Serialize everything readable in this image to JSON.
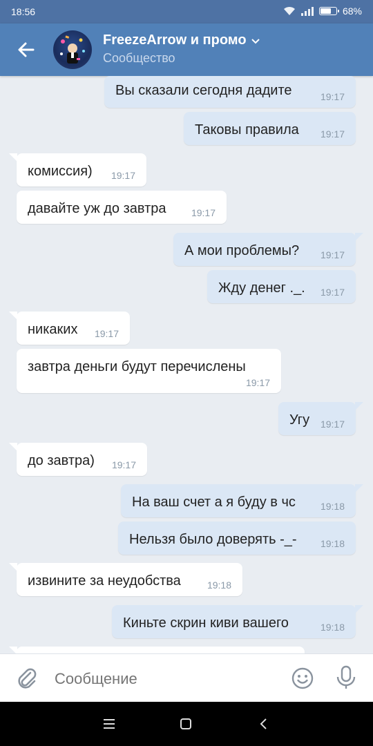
{
  "status_bar": {
    "time": "18:56",
    "battery": "68%",
    "battery_level": 0.68
  },
  "header": {
    "title": "FreezeArrow и промо",
    "subtitle": "Сообщество"
  },
  "messages": [
    {
      "dir": "out",
      "text": "Вы сказали сегодня дадите",
      "time": "19:17"
    },
    {
      "dir": "out",
      "text": "Таковы правила",
      "time": "19:17"
    },
    {
      "dir": "in",
      "text": "комиссия)",
      "time": "19:17"
    },
    {
      "dir": "in",
      "text": "давайте уж до завтра",
      "time": "19:17"
    },
    {
      "dir": "out",
      "text": "А мои проблемы?",
      "time": "19:17"
    },
    {
      "dir": "out",
      "text": "Жду денег ._.",
      "time": "19:17"
    },
    {
      "dir": "in",
      "text": "никаких",
      "time": "19:17"
    },
    {
      "dir": "in",
      "text": "завтра деньги будут перечислены",
      "time": "19:17"
    },
    {
      "dir": "out",
      "text": "Угу",
      "time": "19:17"
    },
    {
      "dir": "in",
      "text": "до завтра)",
      "time": "19:17"
    },
    {
      "dir": "out",
      "text": "На ваш счет а я буду в чс",
      "time": "19:18"
    },
    {
      "dir": "out",
      "text": "Нельзя было доверять -_-",
      "time": "19:18"
    },
    {
      "dir": "in",
      "text": "извините за неудобства",
      "time": "19:18"
    },
    {
      "dir": "out",
      "text": "Киньте скрин киви вашего",
      "time": "19:18"
    }
  ],
  "composer": {
    "placeholder": "Сообщение"
  },
  "icons": {
    "back": "arrow-left-icon",
    "attach": "paperclip-icon",
    "emoji": "smiley-icon",
    "voice": "microphone-icon",
    "nav": [
      "menu-icon",
      "home-square-icon",
      "back-chevron-icon"
    ]
  },
  "colors": {
    "header": "#5181b8",
    "outgoing_bubble": "#dbe7f5",
    "background": "#e9edf2"
  }
}
